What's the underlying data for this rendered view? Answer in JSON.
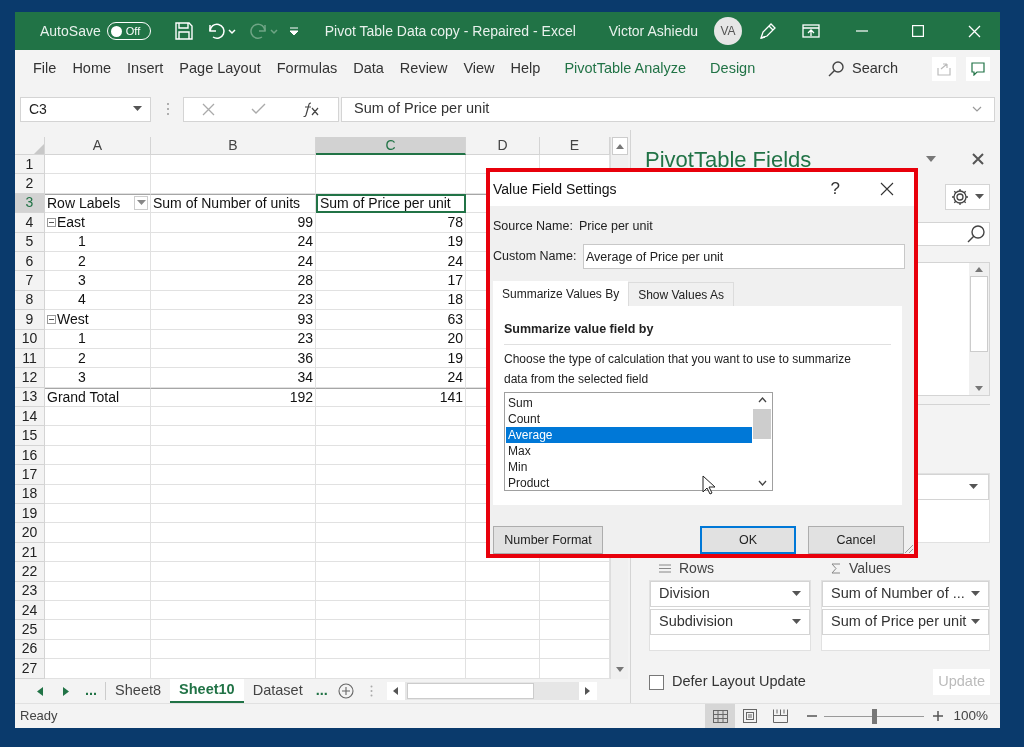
{
  "title_bar": {
    "autosave": {
      "label": "AutoSave",
      "on": false,
      "state_label": "Off"
    },
    "quick_access": [
      {
        "kind": "save",
        "disabled": false
      },
      {
        "kind": "undo",
        "disabled": false
      },
      {
        "kind": "redo",
        "disabled": true
      },
      {
        "kind": "customize",
        "disabled": false
      }
    ],
    "title": "Pivot Table Data copy - Repaired - Excel",
    "user": "Victor Ashiedu",
    "avatar": "VA"
  },
  "ribbon_tabs": [
    {
      "label": "File",
      "kind": "normal"
    },
    {
      "label": "Home",
      "kind": "normal"
    },
    {
      "label": "Insert",
      "kind": "normal"
    },
    {
      "label": "Page Layout",
      "kind": "normal"
    },
    {
      "label": "Formulas",
      "kind": "normal"
    },
    {
      "label": "Data",
      "kind": "normal"
    },
    {
      "label": "Review",
      "kind": "normal"
    },
    {
      "label": "View",
      "kind": "normal"
    },
    {
      "label": "Help",
      "kind": "normal"
    },
    {
      "label": "PivotTable Analyze",
      "kind": "contextual"
    },
    {
      "label": "Design",
      "kind": "contextual"
    }
  ],
  "search": {
    "label": "Search"
  },
  "formula_bar": {
    "name_box": "C3",
    "formula": "Sum of Price per unit"
  },
  "sheet": {
    "columns": [
      {
        "label": "A",
        "selected": false
      },
      {
        "label": "B",
        "selected": false
      },
      {
        "label": "C",
        "selected": true
      },
      {
        "label": "D",
        "selected": false
      },
      {
        "label": "E",
        "selected": false
      }
    ],
    "rows": [
      {
        "number": "1",
        "selected": false,
        "kind": "empty"
      },
      {
        "number": "2",
        "selected": false,
        "kind": "empty"
      },
      {
        "number": "3",
        "selected": true,
        "kind": "header",
        "cells": [
          "Row Labels",
          "Sum of Number of units",
          "Sum of Price per unit"
        ]
      },
      {
        "number": "4",
        "selected": false,
        "kind": "group",
        "cells": [
          "East",
          "99",
          "78"
        ]
      },
      {
        "number": "5",
        "selected": false,
        "kind": "item",
        "cells": [
          "1",
          "24",
          "19"
        ]
      },
      {
        "number": "6",
        "selected": false,
        "kind": "item",
        "cells": [
          "2",
          "24",
          "24"
        ]
      },
      {
        "number": "7",
        "selected": false,
        "kind": "item",
        "cells": [
          "3",
          "28",
          "17"
        ]
      },
      {
        "number": "8",
        "selected": false,
        "kind": "item",
        "cells": [
          "4",
          "23",
          "18"
        ]
      },
      {
        "number": "9",
        "selected": false,
        "kind": "group",
        "cells": [
          "West",
          "93",
          "63"
        ]
      },
      {
        "number": "10",
        "selected": false,
        "kind": "item",
        "cells": [
          "1",
          "23",
          "20"
        ]
      },
      {
        "number": "11",
        "selected": false,
        "kind": "item",
        "cells": [
          "2",
          "36",
          "19"
        ]
      },
      {
        "number": "12",
        "selected": false,
        "kind": "item",
        "cells": [
          "3",
          "34",
          "24"
        ]
      },
      {
        "number": "13",
        "selected": false,
        "kind": "total",
        "cells": [
          "Grand Total",
          "192",
          "141"
        ]
      },
      {
        "number": "14",
        "selected": false,
        "kind": "empty"
      },
      {
        "number": "15",
        "selected": false,
        "kind": "empty"
      },
      {
        "number": "16",
        "selected": false,
        "kind": "empty"
      },
      {
        "number": "17",
        "selected": false,
        "kind": "empty"
      },
      {
        "number": "18",
        "selected": false,
        "kind": "empty"
      },
      {
        "number": "19",
        "selected": false,
        "kind": "empty"
      },
      {
        "number": "20",
        "selected": false,
        "kind": "empty"
      },
      {
        "number": "21",
        "selected": false,
        "kind": "empty"
      },
      {
        "number": "22",
        "selected": false,
        "kind": "empty"
      },
      {
        "number": "23",
        "selected": false,
        "kind": "empty"
      },
      {
        "number": "24",
        "selected": false,
        "kind": "empty"
      },
      {
        "number": "25",
        "selected": false,
        "kind": "empty"
      },
      {
        "number": "26",
        "selected": false,
        "kind": "empty"
      },
      {
        "number": "27",
        "selected": false,
        "kind": "empty"
      }
    ]
  },
  "sheet_tabs": {
    "more_left": "...",
    "items": [
      {
        "label": "Sheet8",
        "selected": false
      },
      {
        "label": "Sheet10",
        "selected": true
      },
      {
        "label": "Dataset",
        "selected": false
      }
    ],
    "more_right": "..."
  },
  "pivot_pane": {
    "title": "PivotTable Fields",
    "areas": [
      {
        "kind": "rows",
        "label": "Rows",
        "items": [
          "Division",
          "Subdivision"
        ]
      },
      {
        "kind": "values",
        "label": "Values",
        "items": [
          "Sum of Number of ...",
          "Sum of Price per unit"
        ]
      }
    ],
    "defer": {
      "label": "Defer Layout Update",
      "checked": false
    },
    "update": {
      "label": "Update",
      "disabled": true
    }
  },
  "status_bar": {
    "status": "Ready",
    "views": [
      {
        "kind": "normal",
        "selected": true
      },
      {
        "kind": "page_layout",
        "selected": false
      },
      {
        "kind": "page_break",
        "selected": false
      }
    ],
    "zoom": {
      "level": 0.5,
      "reading": "100%"
    }
  },
  "dialog": {
    "title": "Value Field Settings",
    "help": "?",
    "source_label": "Source Name:",
    "source_value": "Price per unit",
    "custom_label": "Custom Name:",
    "custom_value": "Average of Price per unit",
    "tabs": [
      {
        "label": "Summarize Values By",
        "selected": true
      },
      {
        "label": "Show Values As",
        "selected": false
      }
    ],
    "section_title": "Summarize value field by",
    "description": "Choose the type of calculation that you want to use to summarize data from the selected field",
    "functions": [
      {
        "label": "Sum",
        "selected": false
      },
      {
        "label": "Count",
        "selected": false
      },
      {
        "label": "Average",
        "selected": true
      },
      {
        "label": "Max",
        "selected": false
      },
      {
        "label": "Min",
        "selected": false
      },
      {
        "label": "Product",
        "selected": false
      }
    ],
    "buttons": [
      {
        "label": "Number Format",
        "kind": "normal"
      },
      {
        "label": "OK",
        "kind": "default"
      },
      {
        "label": "Cancel",
        "kind": "normal"
      }
    ]
  }
}
